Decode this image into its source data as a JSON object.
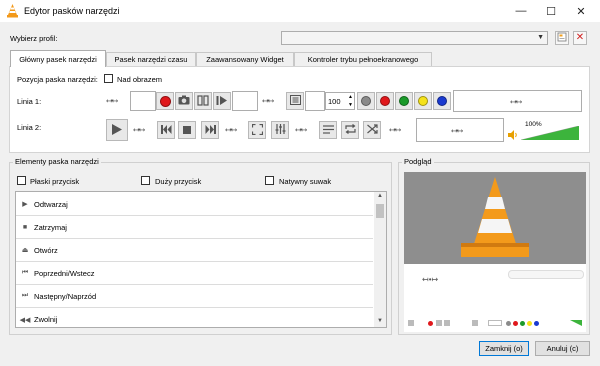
{
  "window": {
    "title": "Edytor pasków narzędzi",
    "minimize_glyph": "—",
    "maximize_glyph": "☐",
    "close_glyph": "✕"
  },
  "profile": {
    "label": "Wybierz profil:",
    "value": "",
    "new_icon": "new-profile-icon",
    "delete_icon": "delete-profile-icon"
  },
  "tabs": [
    {
      "label": "Główny pasek narzędzi",
      "active": true
    },
    {
      "label": "Pasek narzędzi czasu",
      "active": false
    },
    {
      "label": "Zaawansowany Widget",
      "active": false
    },
    {
      "label": "Kontroler trybu pełnoekranowego",
      "active": false
    }
  ],
  "toolbar_tab": {
    "position_label": "Pozycja paska narzędzi:",
    "above_video_label": "Nad obrazem",
    "above_video_checked": false,
    "line1_label": "Linia 1:",
    "line2_label": "Linia 2:",
    "spacer_glyph": "↤•↦",
    "spin_value": "100",
    "volume_percent_text": "100%",
    "volume_level": 1.0,
    "colors": {
      "record": "#e0181c",
      "gray": "#8a8a8a",
      "red": "#e0181c",
      "green": "#1a9a2a",
      "yellow": "#f5e21a",
      "blue": "#1a3ad0",
      "volume": "#3cb43c"
    }
  },
  "elements": {
    "title": "Elementy paska narzędzi",
    "flat_label": "Płaski przycisk",
    "big_label": "Duży przycisk",
    "native_label": "Natywny suwak",
    "items": [
      {
        "icon": "▶",
        "label": "Odtwarzaj"
      },
      {
        "icon": "■",
        "label": "Zatrzymaj"
      },
      {
        "icon": "⏏",
        "label": "Otwórz"
      },
      {
        "icon": "⏮",
        "label": "Poprzedni/Wstecz"
      },
      {
        "icon": "⏭",
        "label": "Następny/Naprzód"
      },
      {
        "icon": "◀◀",
        "label": "Zwolnij"
      }
    ]
  },
  "preview": {
    "title": "Podgląd"
  },
  "buttons": {
    "close": "Zamknij (o)",
    "cancel": "Anuluj (c)"
  }
}
